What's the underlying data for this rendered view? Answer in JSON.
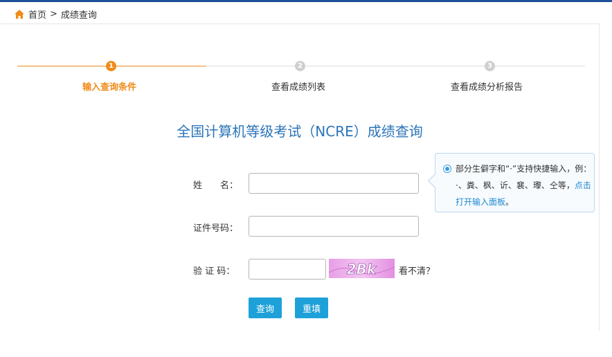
{
  "breadcrumb": {
    "home": "首页",
    "separator": ">",
    "current": "成绩查询"
  },
  "steps": [
    {
      "number": "1",
      "label": "输入查询条件",
      "active": true
    },
    {
      "number": "2",
      "label": "查看成绩列表",
      "active": false
    },
    {
      "number": "3",
      "label": "查看成绩分析报告",
      "active": false
    }
  ],
  "title": "全国计算机等级考试（NCRE）成绩查询",
  "form": {
    "name_label": "姓　　名：",
    "name_value": "",
    "id_label": "证件号码：",
    "id_value": "",
    "captcha_label": "验 证 码：",
    "captcha_value": "",
    "captcha_image_text": "2Bk",
    "refresh_captcha": "看不清？",
    "query_button": "查询",
    "reset_button": "重填"
  },
  "tip": {
    "text": "部分生僻字和“·”支持快捷输入，例：·、粪、枫、䜣、㐮、瓈、仝等，",
    "link": "点击打开输入面板",
    "end": "。"
  },
  "colors": {
    "accent_orange": "#f08c1a",
    "title_blue": "#2a74b8",
    "button_blue": "#1ea1d9",
    "top_bar": "#1d4f9a",
    "step_idle": "#cfcfcf"
  },
  "icons": {
    "home": "home-icon",
    "tip_radio": "radio-selected-icon"
  }
}
